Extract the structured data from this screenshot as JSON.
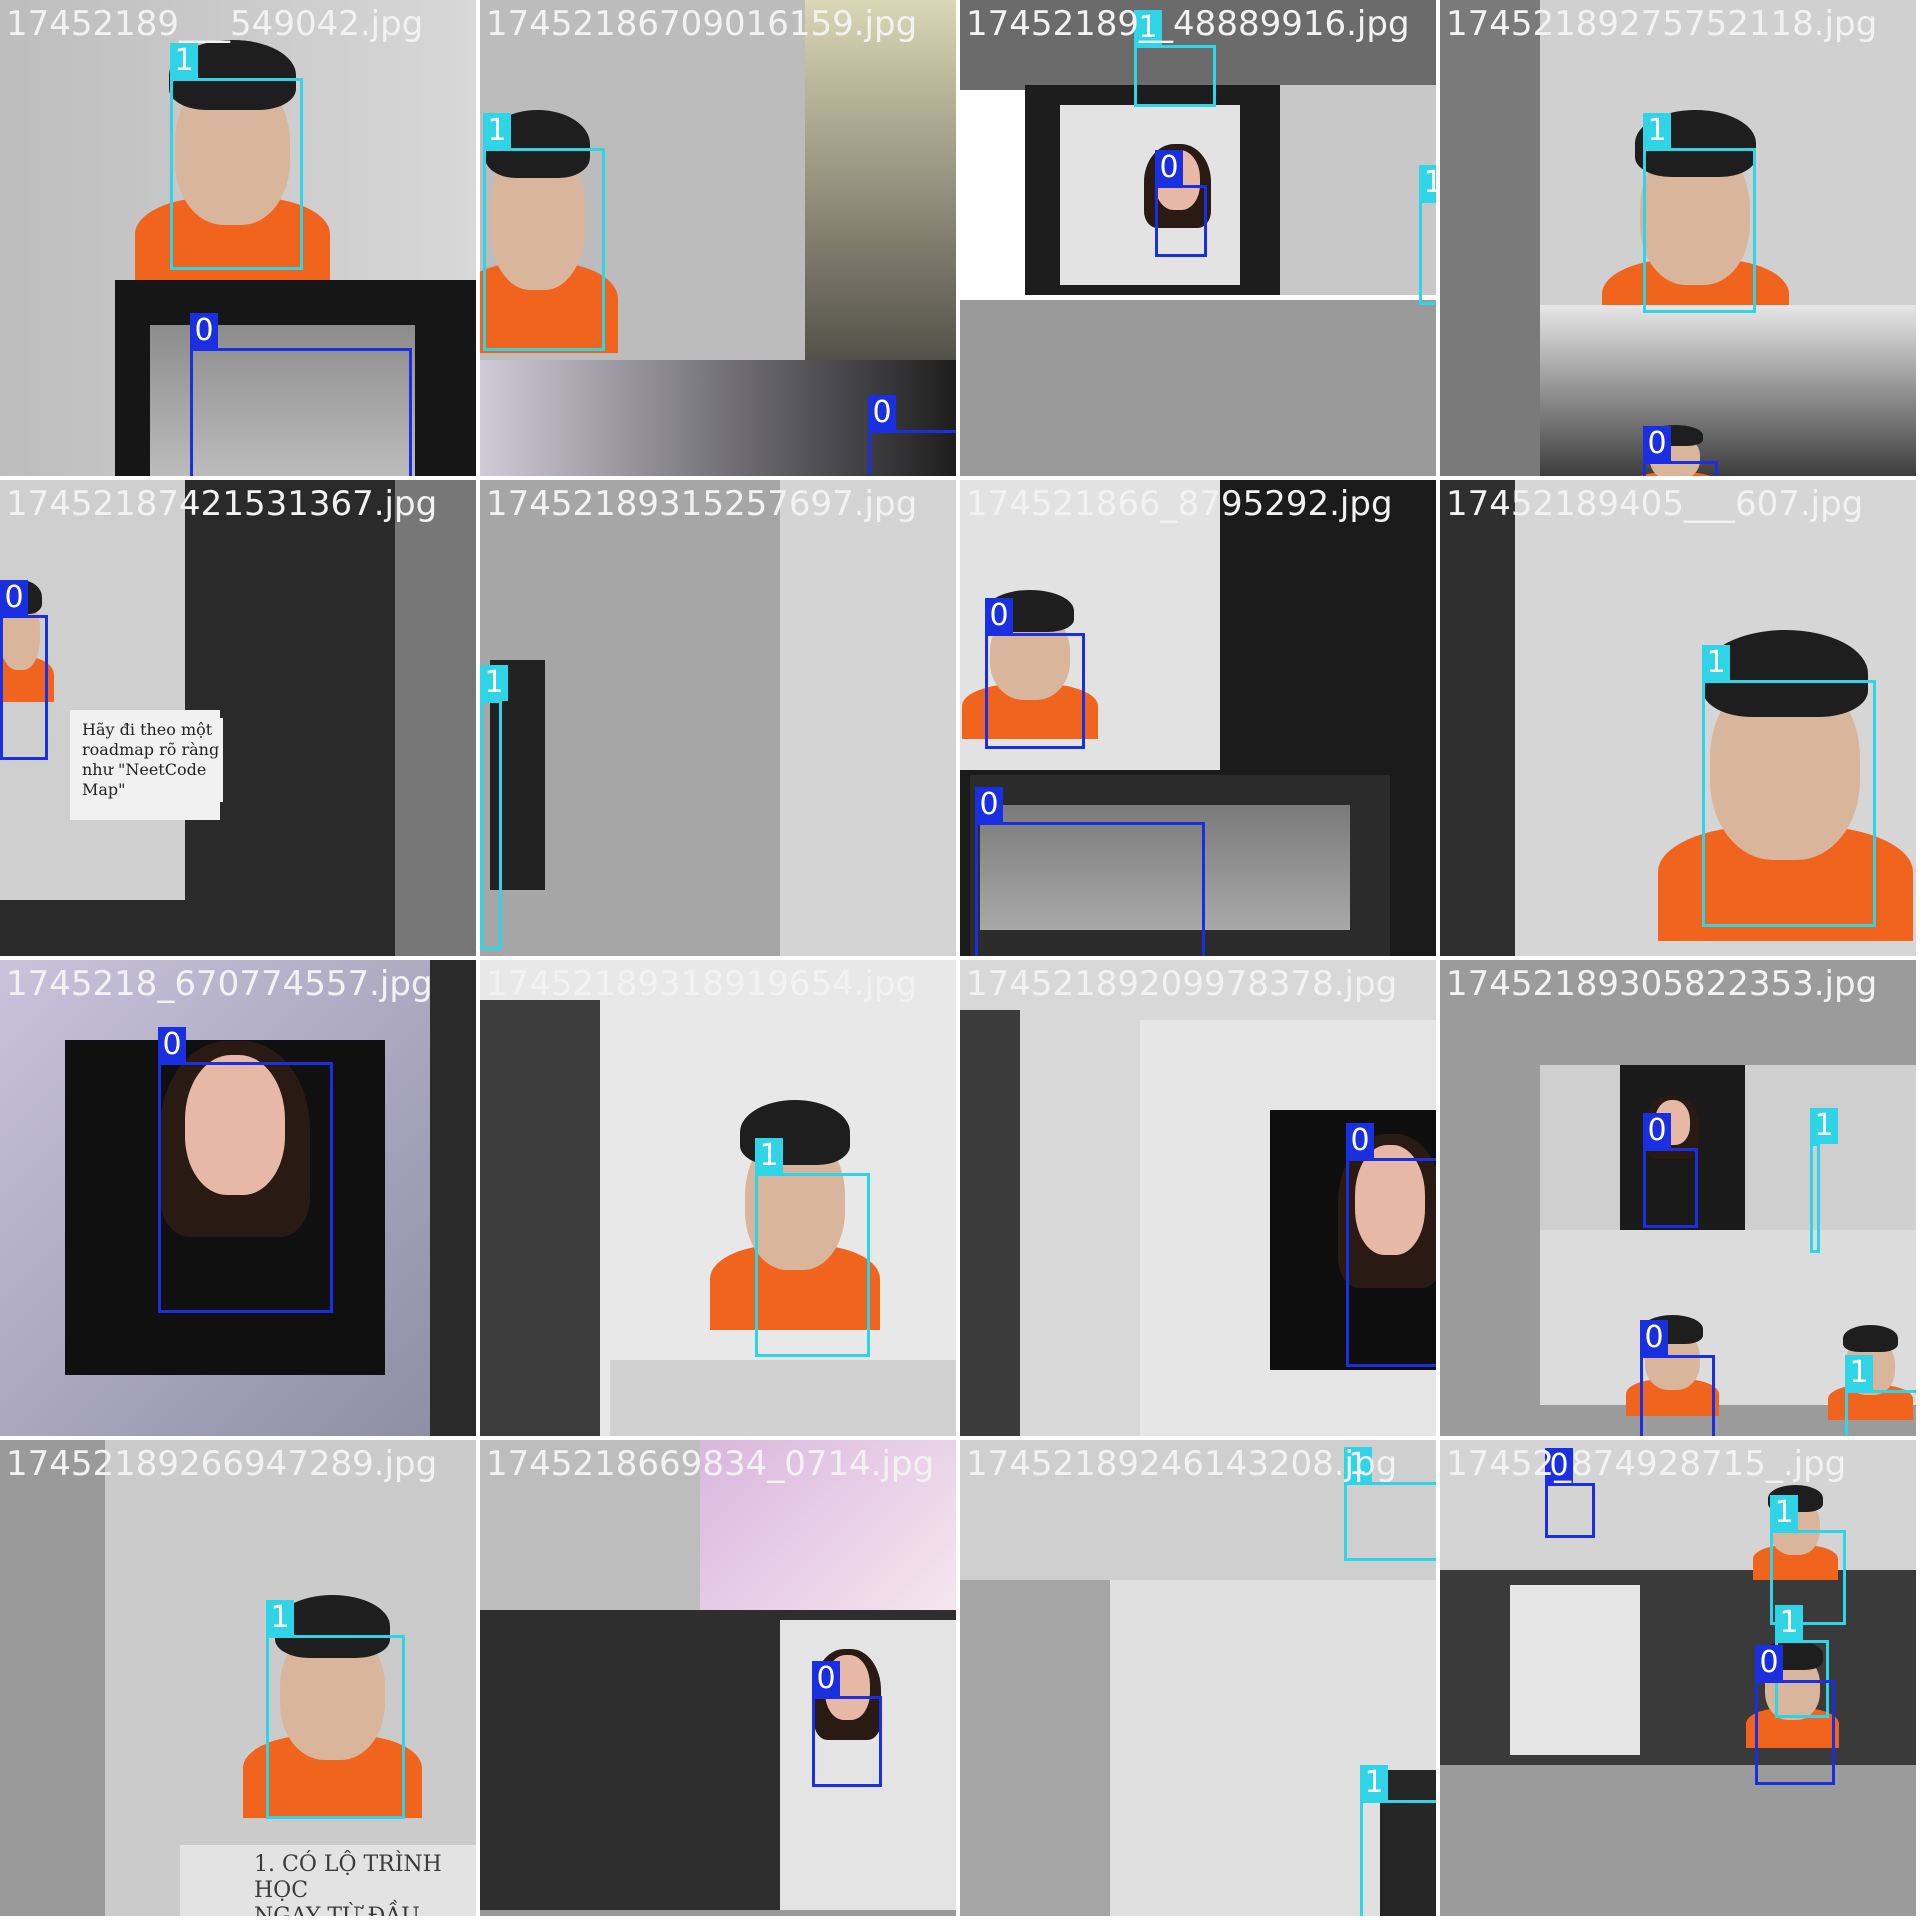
{
  "colors": {
    "class_0": "#1a2fe0",
    "class_1": "#2fd4e6",
    "filename_text": "#f2f2f2",
    "wall_light": "#c9c9c9",
    "wall_dark": "#6d6d6d",
    "skin": "#d9b59c",
    "hair": "#1e1e1e",
    "shirt": "#f0641e",
    "gray_fill": "#9b9b9b"
  },
  "class_names": {
    "0": "0",
    "1": "1"
  },
  "mosaic": {
    "rows": 4,
    "cols": 4,
    "tiles": [
      {
        "filename": "17452189___549042.jpg",
        "scene": "person-room-with-hat-inset",
        "labels": [
          "1",
          "0"
        ]
      },
      {
        "filename": "17452186709016159.jpg",
        "scene": "person-left-with-dark-panel",
        "labels": [
          "1",
          "0"
        ]
      },
      {
        "filename": "17452189__48889916.jpg",
        "scene": "phone-photo-gray-bottom",
        "labels": [
          "1",
          "0",
          "1"
        ]
      },
      {
        "filename": "17452189275752118.jpg",
        "scene": "person-room-with-bottom-inset",
        "labels": [
          "1",
          "0"
        ]
      },
      {
        "filename": "17452187421531367.jpg",
        "scene": "dark-screen-sticker",
        "labels": [
          "0"
        ]
      },
      {
        "filename": "17452189315257697.jpg",
        "scene": "empty-wall-partial-head",
        "labels": [
          "1"
        ]
      },
      {
        "filename": "174521866_8795292.jpg",
        "scene": "screen-poster-with-hat",
        "labels": [
          "0",
          "0"
        ]
      },
      {
        "filename": "17452189405___607.jpg",
        "scene": "person-large-center",
        "labels": [
          "1"
        ]
      },
      {
        "filename": "1745218_670774557.jpg",
        "scene": "screen-portrait-woman",
        "labels": [
          "0"
        ]
      },
      {
        "filename": "17452189318919654.jpg",
        "scene": "person-right-with-panels",
        "labels": [
          "1",
          "0"
        ]
      },
      {
        "filename": "17452189209978378.jpg",
        "scene": "screen-woman-right",
        "labels": [
          "0"
        ]
      },
      {
        "filename": "17452189305822353.jpg",
        "scene": "gray-with-small-mosaic",
        "labels": [
          "0",
          "1",
          "0",
          "1"
        ]
      },
      {
        "filename": "17452189266947289.jpg",
        "scene": "person-room-bottom-text",
        "labels": [
          "1"
        ]
      },
      {
        "filename": "1745218669834_0714.jpg",
        "scene": "phone-woman-collage",
        "labels": [
          "0"
        ]
      },
      {
        "filename": "17452189246143208.jpg",
        "scene": "wall-partial-faces",
        "labels": [
          "1",
          "1"
        ]
      },
      {
        "filename": "17452_874928715_.jpg",
        "scene": "collage-gray-bottom",
        "labels": [
          "0",
          "1",
          "1",
          "0"
        ]
      }
    ]
  },
  "screen_text": {
    "poster_title": "1. CÓ LỘ TRÌNH HỌC",
    "poster_subtitle": "NGAY TỪ ĐẦU",
    "sticker_line1": "Hãy đi theo một",
    "sticker_line2": "roadmap rõ ràng",
    "sticker_line3": "như \"NeetCode",
    "sticker_line4": "Map\""
  }
}
